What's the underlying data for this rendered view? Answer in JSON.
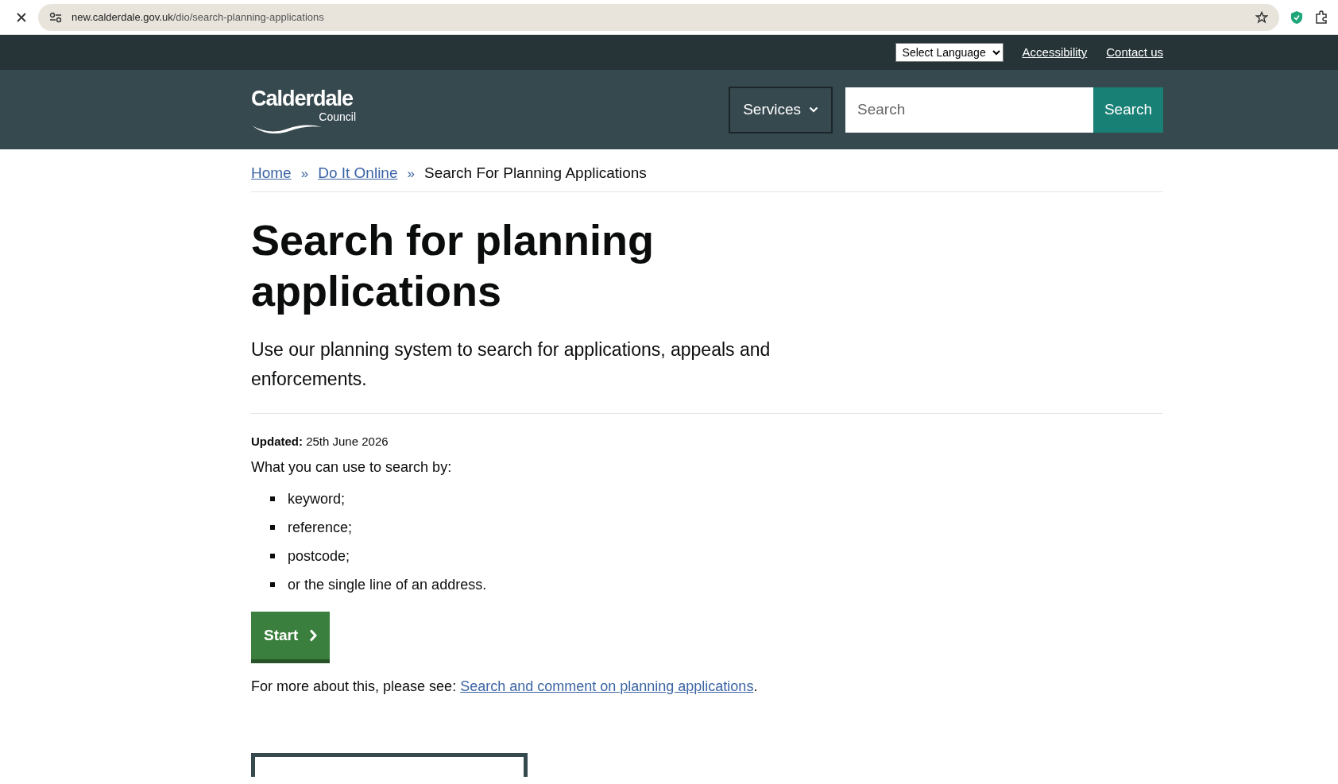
{
  "browser": {
    "url_host": "new.calderdale.gov.uk",
    "url_path": "/dio/search-planning-applications"
  },
  "top_bar": {
    "language_select": "Select Language",
    "links": [
      "Accessibility",
      "Contact us"
    ]
  },
  "header": {
    "logo": {
      "name": "Calderdale",
      "sub": "Council"
    },
    "services_button": "Services",
    "search": {
      "placeholder": "Search",
      "button": "Search"
    }
  },
  "breadcrumb": [
    {
      "label": "Home",
      "link": true
    },
    {
      "label": "»",
      "kind": "separator"
    },
    {
      "label": "Do It Online",
      "link": true
    },
    {
      "label": "»",
      "kind": "separator"
    },
    {
      "label": "Search For Planning Applications",
      "link": false
    }
  ],
  "page": {
    "title": "Search for planning applications",
    "lead": "Use our planning system to search for applications, appeals and enforcements.",
    "updated": "**Updated:** 25th June 2026",
    "intro": "What you can use to search by:",
    "list": [
      "keyword;",
      "reference;",
      "postcode;",
      "or the single line of an address."
    ],
    "start_button": "Start",
    "more_text": "For more about this, please see:",
    "more_link": "Search and comment on planning applications",
    "more_end": "."
  }
}
